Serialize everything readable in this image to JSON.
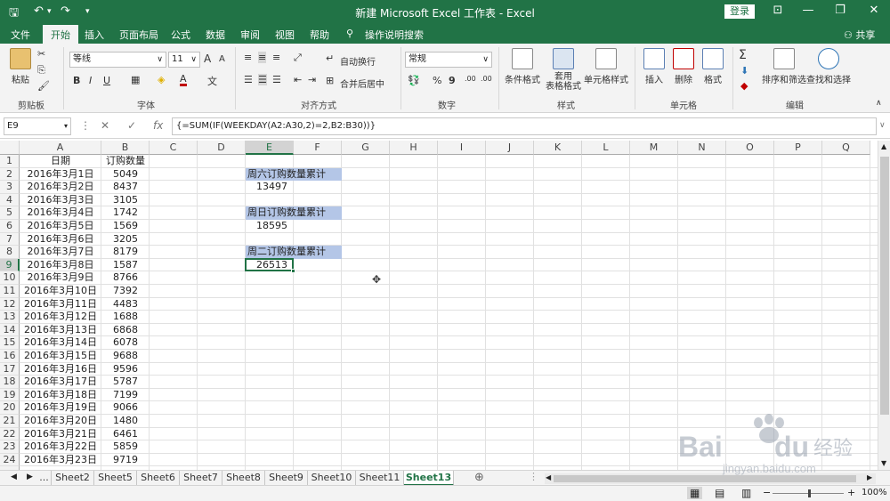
{
  "titlebar": {
    "title": "新建 Microsoft Excel 工作表 - Excel",
    "login": "登录",
    "save_icon": "save-icon",
    "undo_icon": "undo-icon",
    "redo_icon": "redo-icon",
    "customize_icon": "customize-icon",
    "ribbon_display_icon": "ribbon-display-icon",
    "minimize_glyph": "—",
    "restore_glyph": "❐",
    "close_glyph": "✕"
  },
  "tabs": [
    "文件",
    "开始",
    "插入",
    "页面布局",
    "公式",
    "数据",
    "审阅",
    "视图",
    "帮助"
  ],
  "active_tab": "开始",
  "tellme": "操作说明搜索",
  "share": "共享",
  "ribbon": {
    "clipboard": {
      "paste": "粘贴",
      "label": "剪贴板"
    },
    "font": {
      "name": "等线",
      "size": "11",
      "grow": "A",
      "shrink": "A",
      "bold": "B",
      "italic": "I",
      "underline": "U",
      "label": "字体",
      "phonetic": "文"
    },
    "alignment": {
      "wrap": "自动换行",
      "merge": "合并后居中",
      "label": "对齐方式"
    },
    "number": {
      "format": "常规",
      "percent": "%",
      "comma": "9",
      "inc_decimal": ".00",
      "dec_decimal": ".00",
      "label": "数字"
    },
    "styles": {
      "conditional": "条件格式",
      "table_line1": "套用",
      "table_line2": "表格格式",
      "cell_styles": "单元格样式",
      "label": "样式"
    },
    "cells": {
      "insert": "插入",
      "delete": "删除",
      "format": "格式",
      "label": "单元格"
    },
    "editing": {
      "sum": "Σ",
      "sort_filter": "排序和筛选",
      "find_select": "查找和选择",
      "label": "编辑"
    }
  },
  "formula_bar": {
    "name_box": "E9",
    "cancel": "✕",
    "enter": "✓",
    "fx": "fx",
    "formula": "{=SUM(IF(WEEKDAY(A2:A30,2)=2,B2:B30))}"
  },
  "columns": [
    "A",
    "B",
    "C",
    "D",
    "E",
    "F",
    "G",
    "H",
    "I",
    "J",
    "K",
    "L",
    "M",
    "N",
    "O",
    "P",
    "Q"
  ],
  "rows": [
    "1",
    "2",
    "3",
    "4",
    "5",
    "6",
    "7",
    "8",
    "9",
    "10",
    "11",
    "12",
    "13",
    "14",
    "15",
    "16",
    "17",
    "18",
    "19",
    "20",
    "21",
    "22",
    "23",
    "24"
  ],
  "table": {
    "header": [
      "日期",
      "订购数量"
    ],
    "data": [
      [
        "2016年3月1日",
        "5049"
      ],
      [
        "2016年3月2日",
        "8437"
      ],
      [
        "2016年3月3日",
        "3105"
      ],
      [
        "2016年3月4日",
        "1742"
      ],
      [
        "2016年3月5日",
        "1569"
      ],
      [
        "2016年3月6日",
        "3205"
      ],
      [
        "2016年3月7日",
        "8179"
      ],
      [
        "2016年3月8日",
        "1587"
      ],
      [
        "2016年3月9日",
        "8766"
      ],
      [
        "2016年3月10日",
        "7392"
      ],
      [
        "2016年3月11日",
        "4483"
      ],
      [
        "2016年3月12日",
        "1688"
      ],
      [
        "2016年3月13日",
        "6868"
      ],
      [
        "2016年3月14日",
        "6078"
      ],
      [
        "2016年3月15日",
        "9688"
      ],
      [
        "2016年3月16日",
        "9596"
      ],
      [
        "2016年3月17日",
        "5787"
      ],
      [
        "2016年3月18日",
        "7199"
      ],
      [
        "2016年3月19日",
        "9066"
      ],
      [
        "2016年3月20日",
        "1480"
      ],
      [
        "2016年3月21日",
        "6461"
      ],
      [
        "2016年3月22日",
        "5859"
      ],
      [
        "2016年3月23日",
        "9719"
      ]
    ]
  },
  "summary": {
    "sat_label": "周六订购数量累计",
    "sat_value": "13497",
    "sun_label": "周日订购数量累计",
    "sun_value": "18595",
    "tue_label": "周二订购数量累计",
    "tue_value": "26513"
  },
  "sheet_tabs": [
    "...",
    "Sheet2",
    "Sheet5",
    "Sheet6",
    "Sheet7",
    "Sheet8",
    "Sheet9",
    "Sheet10",
    "Sheet11",
    "Sheet13"
  ],
  "active_sheet": "Sheet13",
  "status": {
    "zoom": "100%"
  },
  "watermark": {
    "brand": "Bai",
    "brand2": "du",
    "suffix": "经验",
    "url": "jingyan.baidu.com"
  },
  "colors": {
    "excel_green": "#217346",
    "highlight_blue": "#b4c6e7"
  }
}
